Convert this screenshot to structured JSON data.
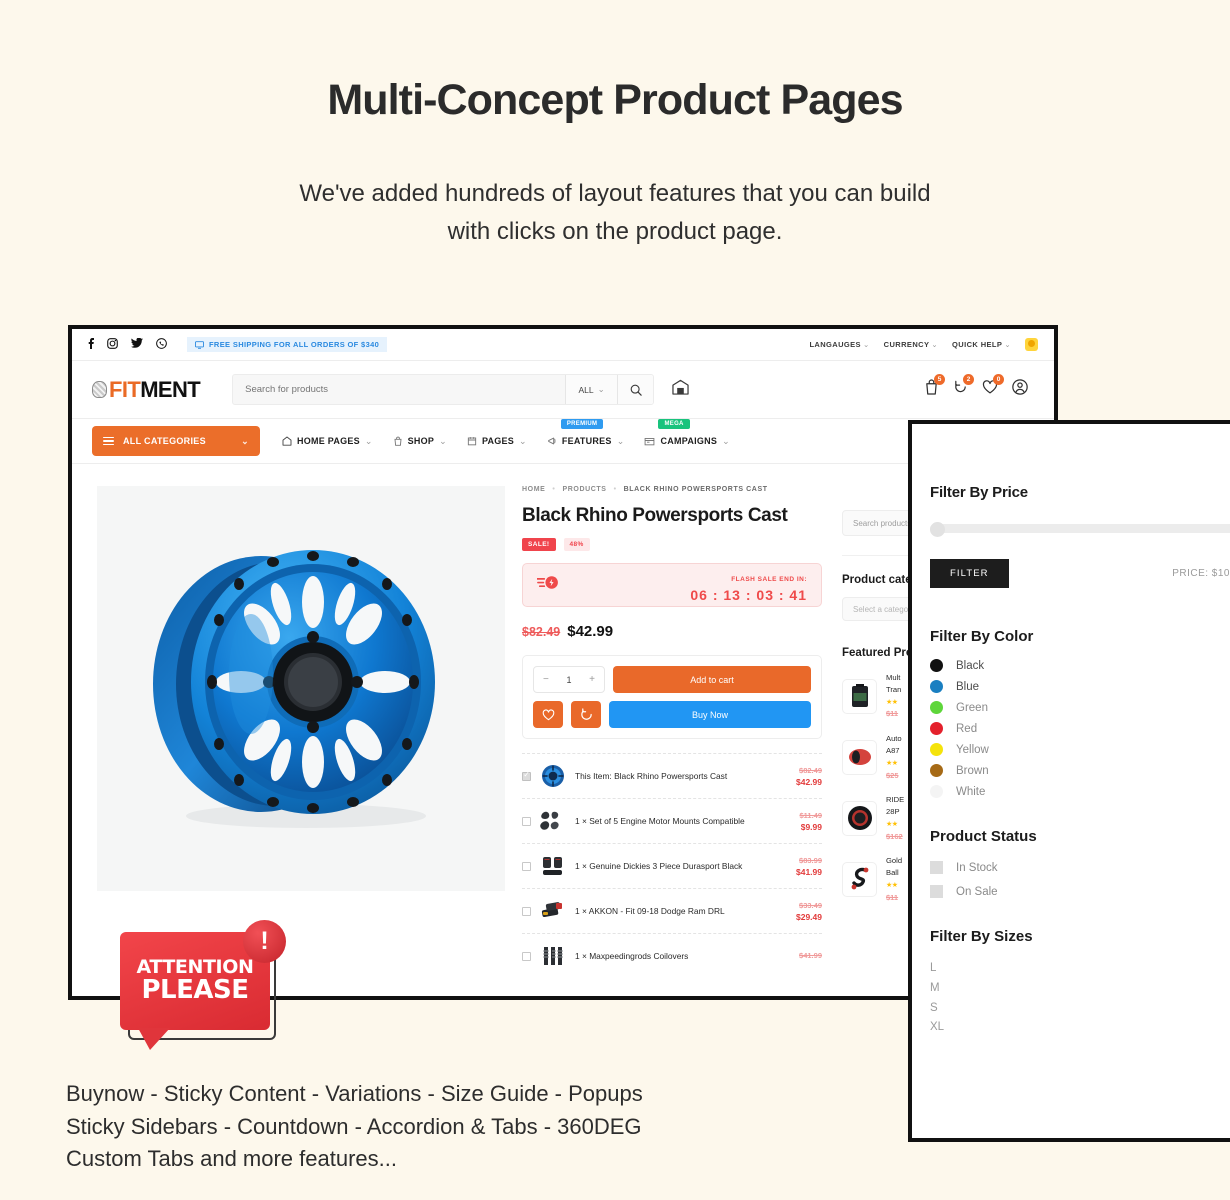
{
  "hero": {
    "title": "Multi-Concept Product Pages",
    "subtitle_line1": "We've added hundreds of layout features that you can build",
    "subtitle_line2": "with clicks on the product page."
  },
  "caption": {
    "line1": "Buynow - Sticky Content - Variations - Size Guide - Popups",
    "line2": "Sticky Sidebars - Countdown - Accordion & Tabs - 360DEG",
    "line3": "Custom Tabs and more features..."
  },
  "attention": {
    "line1": "ATTENTION",
    "line2": "PLEASE",
    "mark": "!"
  },
  "topbar": {
    "social": [
      "f",
      "▣",
      "✐",
      "✆"
    ],
    "shipping": "FREE SHIPPING FOR ALL ORDERS OF $340",
    "right": [
      "LANGAUGES",
      "CURRENCY",
      "QUICK HELP"
    ]
  },
  "header": {
    "logo_fit": "FIT",
    "logo_ment": "MENT",
    "search_placeholder": "Search for products",
    "search_value": "",
    "search_scope": "ALL",
    "badges": {
      "cart": "5",
      "compare": "2",
      "wishlist": "0"
    }
  },
  "nav": {
    "all_categories": "ALL CATEGORIES",
    "items": [
      {
        "label": "HOME PAGES",
        "icon": "home-icon",
        "badge": ""
      },
      {
        "label": "SHOP",
        "icon": "shop-icon",
        "badge": ""
      },
      {
        "label": "PAGES",
        "icon": "pages-icon",
        "badge": ""
      },
      {
        "label": "FEATURES",
        "icon": "features-icon",
        "badge": "PREMIUM"
      },
      {
        "label": "CAMPAIGNS",
        "icon": "campaigns-icon",
        "badge": "MEGA"
      }
    ]
  },
  "product": {
    "breadcrumb": [
      "HOME",
      "PRODUCTS",
      "BLACK RHINO POWERSPORTS CAST"
    ],
    "title": "Black Rhino Powersports Cast",
    "tag_sale": "SALE!",
    "tag_percent": "48%",
    "flash_label": "FLASH SALE END IN:",
    "flash_time": "06 : 13 : 03 : 41",
    "price_old": "$82.49",
    "price_new": "$42.99",
    "qty": "1",
    "add_to_cart": "Add to cart",
    "buy_now": "Buy Now",
    "wishlist_icon": "heart-icon",
    "compare_icon": "compare-icon"
  },
  "bundle": [
    {
      "checked": true,
      "name": "This Item: Black Rhino Powersports Cast",
      "old": "$82.49",
      "new": "$42.99",
      "thumb": "wheel-thumb"
    },
    {
      "checked": false,
      "name": "1 × Set of 5 Engine Motor Mounts Compatible",
      "old": "$11.49",
      "new": "$9.99",
      "thumb": "motor-mounts-thumb"
    },
    {
      "checked": false,
      "name": "1 × Genuine Dickies 3 Piece Durasport Black",
      "old": "$83.99",
      "new": "$41.99",
      "thumb": "floor-mats-thumb"
    },
    {
      "checked": false,
      "name": "1 × AKKON - Fit 09-18 Dodge Ram DRL",
      "old": "$33.49",
      "new": "$29.49",
      "thumb": "drl-thumb"
    },
    {
      "checked": false,
      "name": "1 × Maxpeedingrods Coilovers",
      "old": "$41.99",
      "new": "",
      "thumb": "coilover-thumb"
    }
  ],
  "sidebar": {
    "search_placeholder": "Search products",
    "categories_heading": "Product categories",
    "category_placeholder": "Select a category",
    "featured_heading": "Featured Products",
    "featured": [
      {
        "name_l1": "Mult",
        "name_l2": "Tran",
        "stars": "★★",
        "price": "$11"
      },
      {
        "name_l1": "Auto",
        "name_l2": "A87",
        "stars": "★★",
        "price": "$25"
      },
      {
        "name_l1": "RIDE",
        "name_l2": "28P",
        "stars": "★★",
        "price": "$162"
      },
      {
        "name_l1": "Gold",
        "name_l2": "Ball",
        "stars": "★★",
        "price": "$11"
      }
    ]
  },
  "filterpanel": {
    "price_heading": "Filter By Price",
    "filter_button": "FILTER",
    "price_label": "PRICE: $10",
    "color_heading": "Filter By Color",
    "colors": [
      {
        "label": "Black",
        "hex": "#111111"
      },
      {
        "label": "Blue",
        "hex": "#1a7fc1"
      },
      {
        "label": "Green",
        "hex": "#5ed63a"
      },
      {
        "label": "Red",
        "hex": "#e4212c"
      },
      {
        "label": "Yellow",
        "hex": "#f5e30b"
      },
      {
        "label": "Brown",
        "hex": "#a66a16"
      },
      {
        "label": "White",
        "hex": "#f4f4f4"
      }
    ],
    "status_heading": "Product Status",
    "statuses": [
      "In Stock",
      "On Sale"
    ],
    "sizes_heading": "Filter By Sizes",
    "sizes": [
      "L",
      "M",
      "S",
      "XL"
    ]
  },
  "theme": {
    "background": "#fdf8ec",
    "accent_orange": "#e9692a",
    "accent_blue": "#2196f3",
    "sale_red": "#f0444c"
  }
}
